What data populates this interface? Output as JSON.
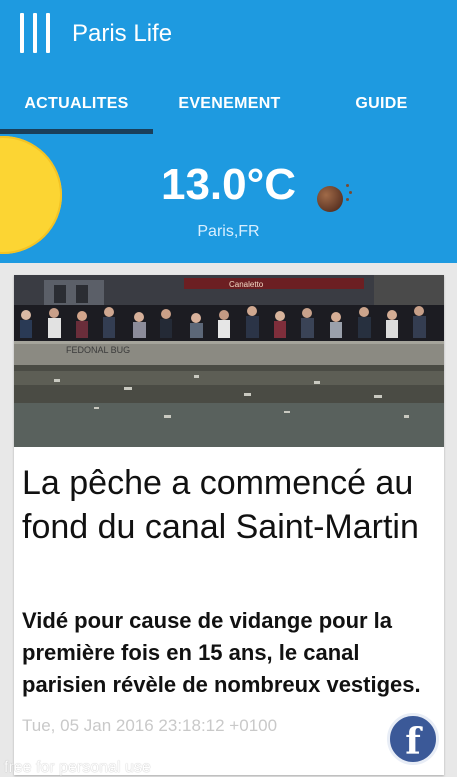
{
  "app": {
    "title": "Paris Life"
  },
  "icons": {
    "menu": "hamburger-menu-icon",
    "weather": "weather-icon",
    "facebook": "facebook-icon"
  },
  "tabs": [
    {
      "label": "ACTUALITES",
      "selected": true
    },
    {
      "label": "EVENEMENT",
      "selected": false
    },
    {
      "label": "GUIDE",
      "selected": false
    }
  ],
  "weather": {
    "temperature": "13.0°C",
    "location": "Paris,FR"
  },
  "article": {
    "photo_sign": "Canaletto",
    "photo_wall_text": "FEDONAL BUG",
    "headline": "La pêche a commencé au fond du canal Saint-Martin",
    "summary": "Vidé pour cause de vidange pour la première fois en 15 ans, le canal parisien révèle de nombreux vestiges.",
    "date": "Tue, 05 Jan 2016 23:18:12 +0100",
    "share_label": "f"
  },
  "watermark": "free for personal use",
  "colors": {
    "appbar": "#1e9ae0",
    "tab_indicator": "#1a3f5a",
    "sun": "#fcd533",
    "facebook": "#3b5998"
  }
}
